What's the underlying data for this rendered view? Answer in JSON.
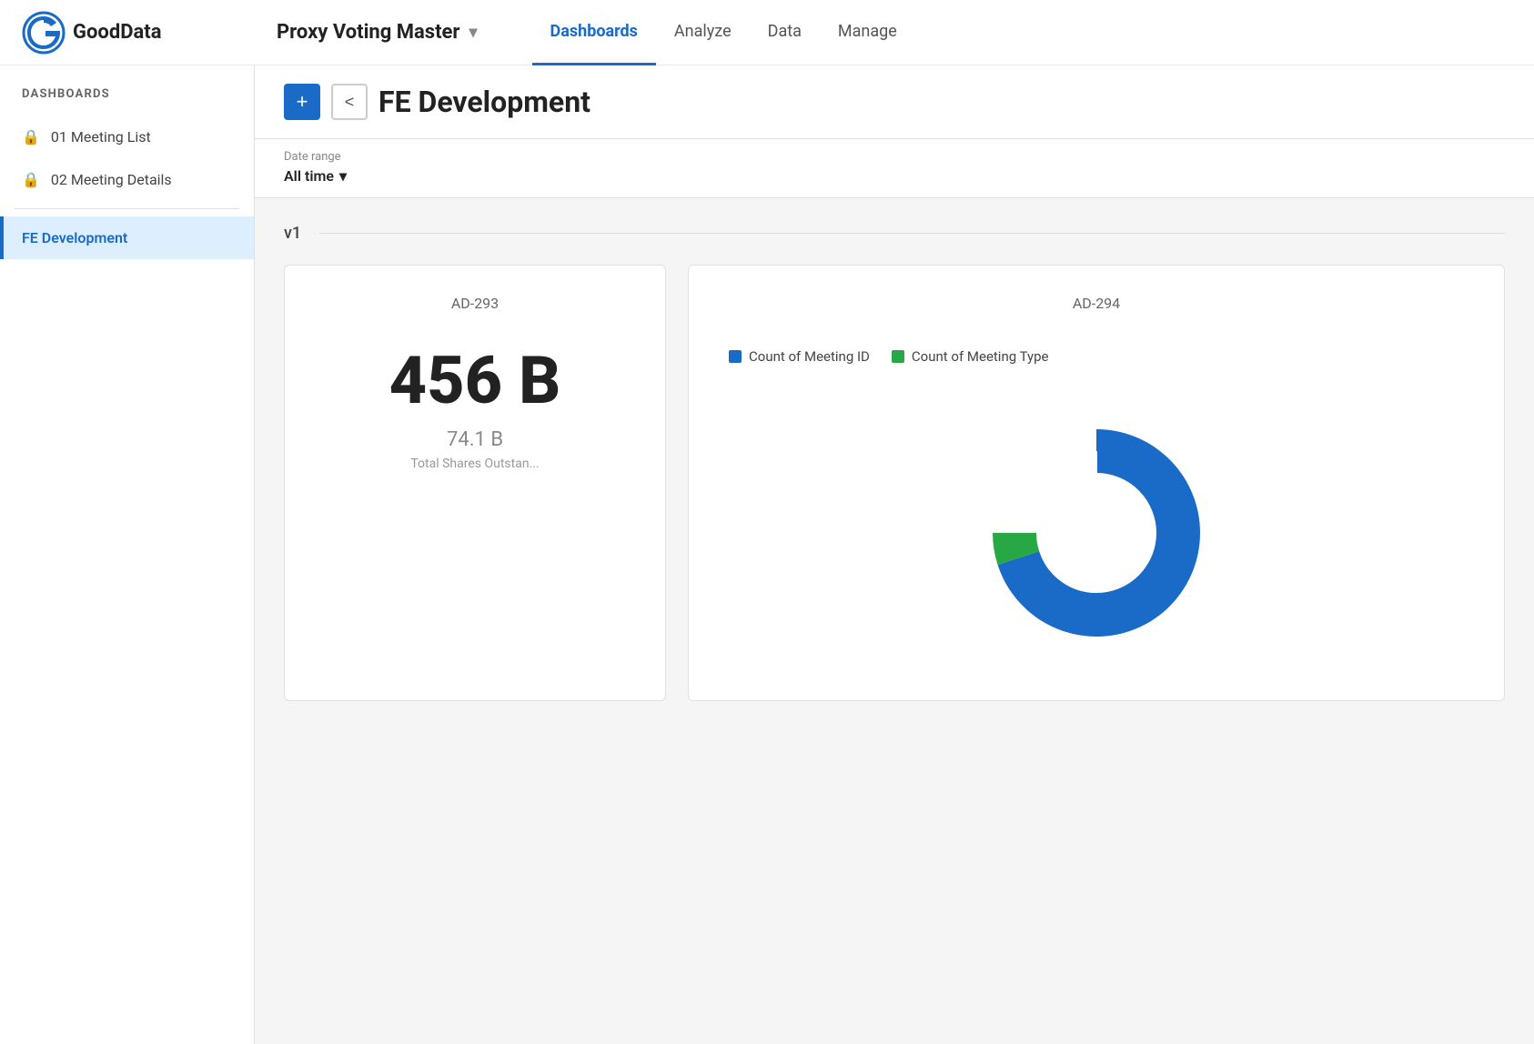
{
  "logo": {
    "text": "GoodData"
  },
  "project": {
    "name": "Proxy Voting Master"
  },
  "nav": {
    "links": [
      {
        "label": "Dashboards",
        "active": true
      },
      {
        "label": "Analyze",
        "active": false
      },
      {
        "label": "Data",
        "active": false
      },
      {
        "label": "Manage",
        "active": false
      }
    ]
  },
  "sidebar": {
    "header": "DASHBOARDS",
    "items": [
      {
        "label": "01 Meeting List",
        "locked": true,
        "active": false
      },
      {
        "label": "02 Meeting Details",
        "locked": true,
        "active": false
      },
      {
        "label": "FE Development",
        "locked": false,
        "active": true
      }
    ]
  },
  "dashboard": {
    "title": "FE Development",
    "add_label": "+",
    "back_label": "<"
  },
  "filter": {
    "label": "Date range",
    "value": "All time"
  },
  "section": {
    "label": "v1"
  },
  "widgets": {
    "widget1": {
      "ad_label": "AD-293",
      "big_number": "456 B",
      "sub_number": "74.1 B",
      "sub_label": "Total Shares Outstan..."
    },
    "widget2": {
      "ad_label": "AD-294",
      "legend": [
        {
          "label": "Count of Meeting ID",
          "color": "#1a6ac8"
        },
        {
          "label": "Count of Meeting Type",
          "color": "#28a745"
        }
      ],
      "donut": {
        "blue_pct": 95,
        "green_pct": 5
      }
    }
  }
}
